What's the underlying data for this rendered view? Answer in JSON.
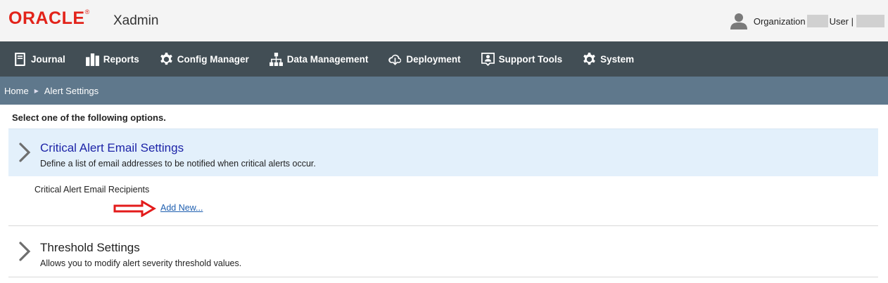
{
  "header": {
    "logo_text": "ORACLE",
    "registered_mark": "®",
    "app_name": "Xadmin",
    "org_label": "Organization",
    "user_label": "User |"
  },
  "nav": {
    "items": [
      {
        "label": "Journal",
        "icon": "book-icon"
      },
      {
        "label": "Reports",
        "icon": "bar-chart-icon"
      },
      {
        "label": "Config Manager",
        "icon": "gear-icon"
      },
      {
        "label": "Data Management",
        "icon": "hierarchy-icon"
      },
      {
        "label": "Deployment",
        "icon": "cloud-download-icon"
      },
      {
        "label": "Support Tools",
        "icon": "support-person-icon"
      },
      {
        "label": "System",
        "icon": "gear-icon"
      }
    ]
  },
  "breadcrumb": {
    "home": "Home",
    "current": "Alert Settings"
  },
  "main": {
    "instruction": "Select one of the following options.",
    "sections": [
      {
        "title": "Critical Alert Email Settings",
        "description": "Define a list of email addresses to be notified when critical alerts occur.",
        "recipients_label": "Critical Alert Email Recipients",
        "add_new_label": "Add New..."
      },
      {
        "title": "Threshold Settings",
        "description": "Allows you to modify alert severity threshold values."
      }
    ]
  },
  "colors": {
    "brand_red": "#e2231a",
    "navbar_bg": "#424e55",
    "breadcrumb_bg": "#5f788c",
    "active_section_bg": "#e3f0fb",
    "active_title": "#1d24a8",
    "link": "#1f5fb0",
    "annotation_arrow": "#e31b1b"
  }
}
